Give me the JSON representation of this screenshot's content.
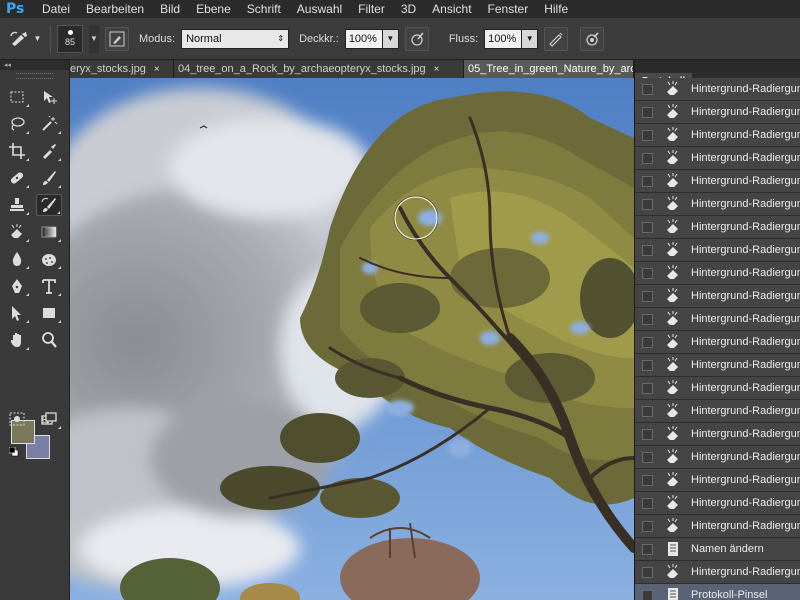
{
  "app": {
    "logo": "Ps"
  },
  "menu": [
    "Datei",
    "Bearbeiten",
    "Bild",
    "Ebene",
    "Schrift",
    "Auswahl",
    "Filter",
    "3D",
    "Ansicht",
    "Fenster",
    "Hilfe"
  ],
  "options": {
    "brush_size": "85",
    "mode_label": "Modus:",
    "mode_value": "Normal",
    "opacity_label": "Deckkr.:",
    "opacity_value": "100%",
    "flow_label": "Fluss:",
    "flow_value": "100%"
  },
  "tabs": [
    {
      "label": "eryx_stocks.jpg",
      "close": "×",
      "active": false
    },
    {
      "label": "04_tree_on_a_Rock_by_archaeopteryx_stocks.jpg",
      "close": "×",
      "active": false
    },
    {
      "label": "05_Tree_in_green_Nature_by_arc",
      "close": "",
      "active": true
    }
  ],
  "colors": {
    "foreground": "#7a7858",
    "background": "#7a80a4",
    "accent": "#3aa8f2",
    "selected_row": "#5a6275"
  },
  "history": {
    "panel_title": "Protokoll",
    "items": [
      {
        "label": "Hintergrund-Radiergummi",
        "icon": "eraser-brush-icon",
        "selected": false
      },
      {
        "label": "Hintergrund-Radiergummi",
        "icon": "eraser-brush-icon",
        "selected": false
      },
      {
        "label": "Hintergrund-Radiergummi",
        "icon": "eraser-brush-icon",
        "selected": false
      },
      {
        "label": "Hintergrund-Radiergummi",
        "icon": "eraser-brush-icon",
        "selected": false
      },
      {
        "label": "Hintergrund-Radiergummi",
        "icon": "eraser-brush-icon",
        "selected": false
      },
      {
        "label": "Hintergrund-Radiergummi",
        "icon": "eraser-brush-icon",
        "selected": false
      },
      {
        "label": "Hintergrund-Radiergummi",
        "icon": "eraser-brush-icon",
        "selected": false
      },
      {
        "label": "Hintergrund-Radiergummi",
        "icon": "eraser-brush-icon",
        "selected": false
      },
      {
        "label": "Hintergrund-Radiergummi",
        "icon": "eraser-brush-icon",
        "selected": false
      },
      {
        "label": "Hintergrund-Radiergummi",
        "icon": "eraser-brush-icon",
        "selected": false
      },
      {
        "label": "Hintergrund-Radiergummi",
        "icon": "eraser-brush-icon",
        "selected": false
      },
      {
        "label": "Hintergrund-Radiergummi",
        "icon": "eraser-brush-icon",
        "selected": false
      },
      {
        "label": "Hintergrund-Radiergummi",
        "icon": "eraser-brush-icon",
        "selected": false
      },
      {
        "label": "Hintergrund-Radiergummi",
        "icon": "eraser-brush-icon",
        "selected": false
      },
      {
        "label": "Hintergrund-Radiergummi",
        "icon": "eraser-brush-icon",
        "selected": false
      },
      {
        "label": "Hintergrund-Radiergummi",
        "icon": "eraser-brush-icon",
        "selected": false
      },
      {
        "label": "Hintergrund-Radiergummi",
        "icon": "eraser-brush-icon",
        "selected": false
      },
      {
        "label": "Hintergrund-Radiergummi",
        "icon": "eraser-brush-icon",
        "selected": false
      },
      {
        "label": "Hintergrund-Radiergummi",
        "icon": "eraser-brush-icon",
        "selected": false
      },
      {
        "label": "Hintergrund-Radiergummi",
        "icon": "eraser-brush-icon",
        "selected": false
      },
      {
        "label": "Namen ändern",
        "icon": "document-icon",
        "selected": false
      },
      {
        "label": "Hintergrund-Radiergummi",
        "icon": "eraser-brush-icon",
        "selected": false
      },
      {
        "label": "Protokoll-Pinsel",
        "icon": "document-icon",
        "selected": true
      }
    ]
  }
}
